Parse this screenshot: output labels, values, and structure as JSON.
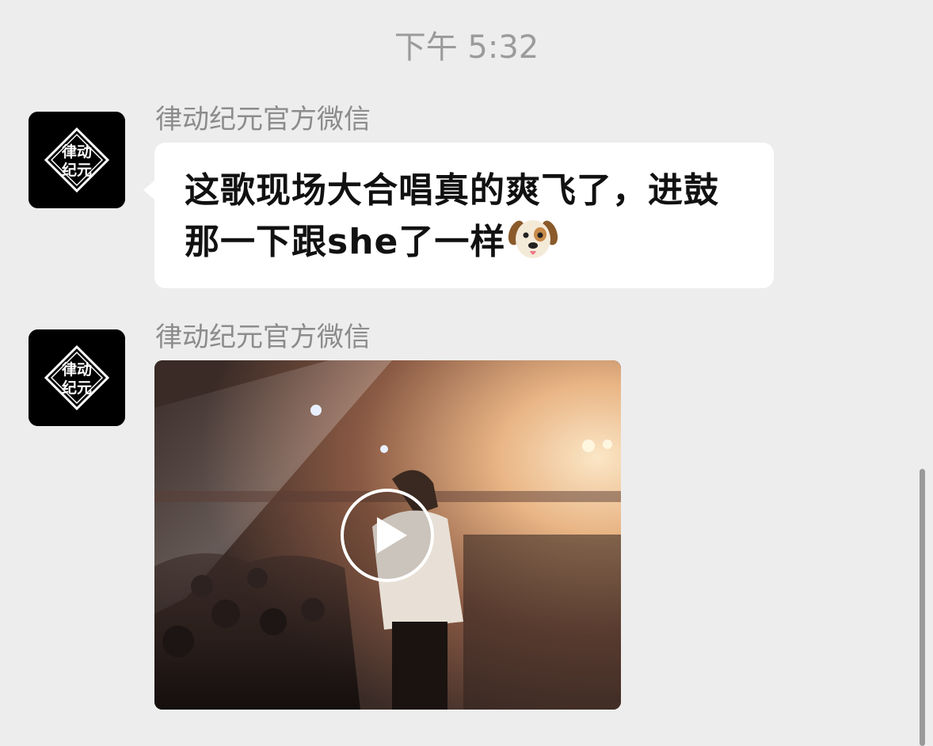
{
  "timestamp": "下午 5:32",
  "messages": [
    {
      "type": "text",
      "sender": "律动纪元官方微信",
      "avatar_text": [
        "律动",
        "纪元"
      ],
      "text": "这歌现场大合唱真的爽飞了，进鼓那一下跟she了一样",
      "emoji": "dog-face-icon"
    },
    {
      "type": "video",
      "sender": "律动纪元官方微信",
      "avatar_text": [
        "律动",
        "纪元"
      ],
      "control": "play-icon"
    }
  ]
}
